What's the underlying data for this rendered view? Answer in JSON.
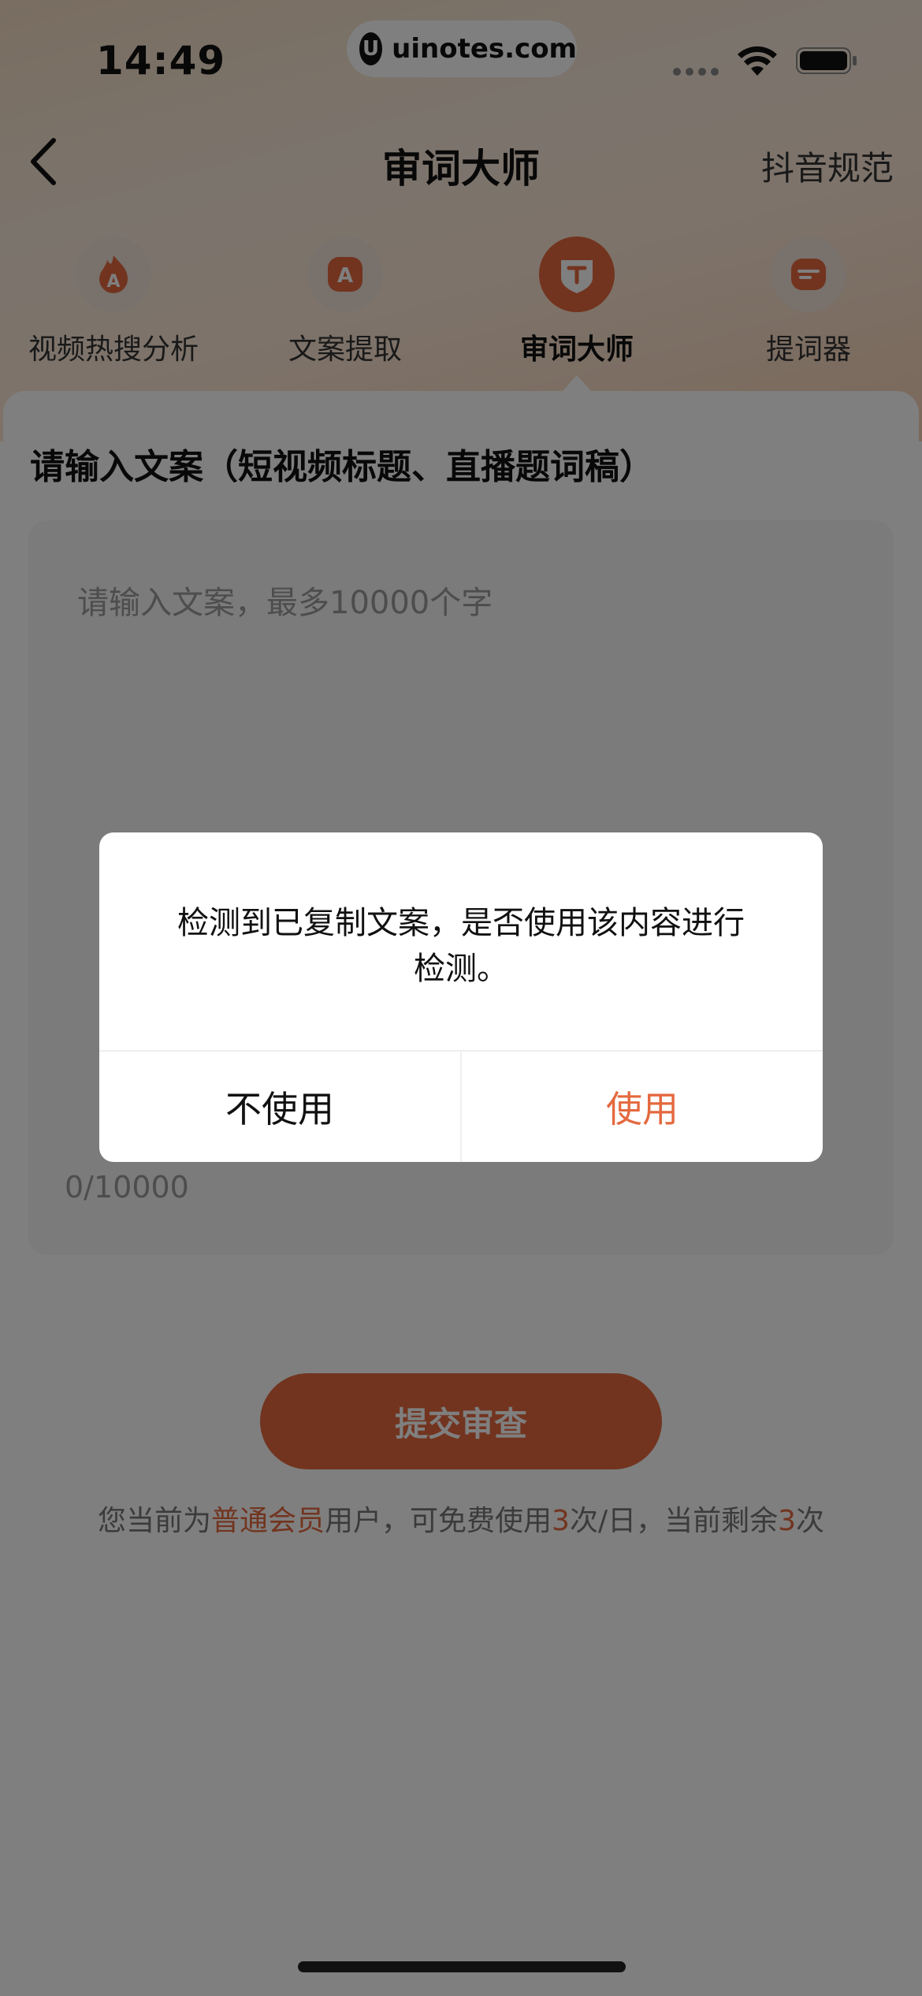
{
  "status_bar": {
    "time": "14:49",
    "watermark": "uinotes.com",
    "watermark_logo": "U"
  },
  "nav": {
    "back_icon": "chevron-left-icon",
    "title": "审词大师",
    "right_link": "抖音规范"
  },
  "tabs": [
    {
      "label": "视频热搜分析",
      "icon": "flame-icon",
      "active": false
    },
    {
      "label": "文案提取",
      "icon": "text-extract-icon",
      "active": false
    },
    {
      "label": "审词大师",
      "icon": "shield-text-icon",
      "active": true
    },
    {
      "label": "提词器",
      "icon": "teleprompter-icon",
      "active": false
    }
  ],
  "main": {
    "section_title": "请输入文案（短视频标题、直播题词稿）",
    "placeholder": "请输入文案，最多10000个字",
    "counter": "0/10000",
    "submit_label": "提交审查",
    "quota": {
      "prefix": "您当前为",
      "member_type": "普通会员",
      "middle": "用户，可免费使用",
      "free_count": "3",
      "per_day": "次/日，当前剩余",
      "remaining": "3",
      "suffix": "次"
    }
  },
  "dialog": {
    "message": "检测到已复制文案，是否使用该内容进行检测。",
    "cancel_label": "不使用",
    "confirm_label": "使用"
  },
  "colors": {
    "accent": "#e4693f",
    "overlay": "rgba(0,0,0,0.5)"
  }
}
